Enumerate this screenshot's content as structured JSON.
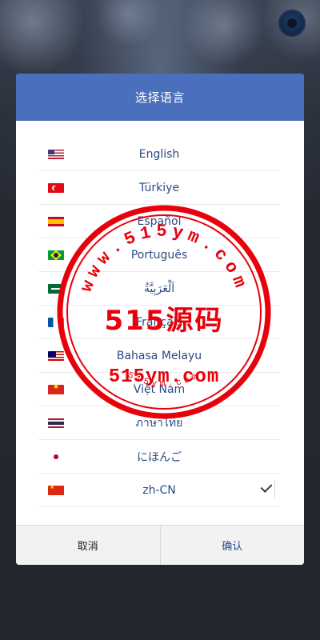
{
  "modal": {
    "title": "选择语言",
    "cancel_label": "取消",
    "confirm_label": "确认"
  },
  "languages": [
    {
      "label": "English",
      "flag": "us-flag-icon"
    },
    {
      "label": "Türkiye",
      "flag": "turkey-flag-icon"
    },
    {
      "label": "Español",
      "flag": "spain-flag-icon"
    },
    {
      "label": "Português",
      "flag": "brazil-flag-icon"
    },
    {
      "label": "اَلْعَرَبِيَّةُ",
      "flag": "saudi-flag-icon"
    },
    {
      "label": "Français",
      "flag": "france-flag-icon"
    },
    {
      "label": "Bahasa Melayu",
      "flag": "malaysia-flag-icon"
    },
    {
      "label": "Việt Nam",
      "flag": "vietnam-flag-icon"
    },
    {
      "label": "ภาษาไทย",
      "flag": "thailand-flag-icon"
    },
    {
      "label": "にほんご",
      "flag": "japan-flag-icon"
    },
    {
      "label": "zh-CN",
      "flag": "china-flag-icon",
      "selected": true
    }
  ],
  "watermark": {
    "ring_text": "www.515ym.com",
    "center_text": "515源码",
    "url_text": "515ym.com",
    "bottom_text": "515ym.com"
  },
  "colors": {
    "header": "#4a6fbd",
    "label": "#2c4a86",
    "stamp": "#e8000b"
  }
}
